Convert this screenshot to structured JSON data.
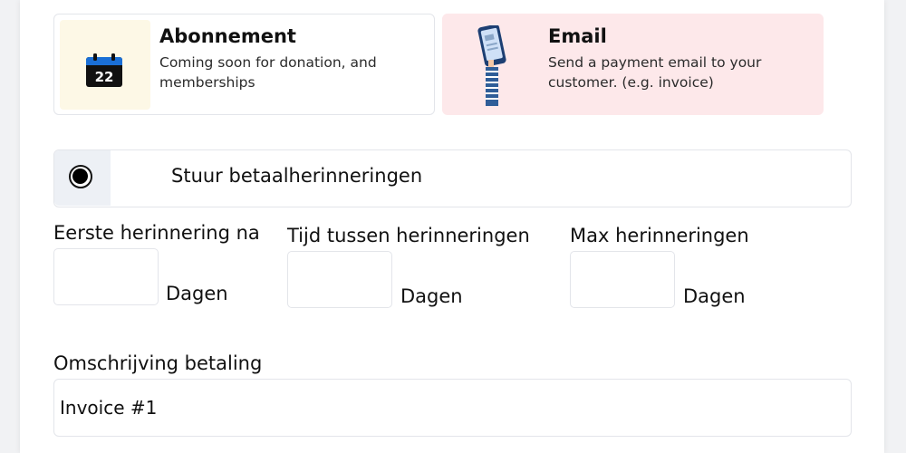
{
  "cards": [
    {
      "title": "Abonnement",
      "description": "Coming soon for donation, and memberships",
      "icon": "calendar-icon",
      "calendar_day": "22"
    },
    {
      "title": "Email",
      "description": "Send a payment email to your customer. (e.g. invoice)",
      "icon": "phone-payment-icon"
    }
  ],
  "reminders": {
    "toggle_label": "Stuur betaalherinneringen",
    "toggle_checked": true,
    "fields": [
      {
        "label": "Eerste herinnering na",
        "value": "",
        "unit": "Dagen"
      },
      {
        "label": "Tijd tussen herinneringen",
        "value": "",
        "unit": "Dagen"
      },
      {
        "label": "Max herinneringen",
        "value": "",
        "unit": "Dagen"
      }
    ]
  },
  "payment_description": {
    "label": "Omschrijving betaling",
    "value": "Invoice #1"
  },
  "colors": {
    "email_card_bg": "#fde8ea",
    "icon_box_bg": "#fdf8e6",
    "radio_box_bg": "#edf0f5"
  }
}
